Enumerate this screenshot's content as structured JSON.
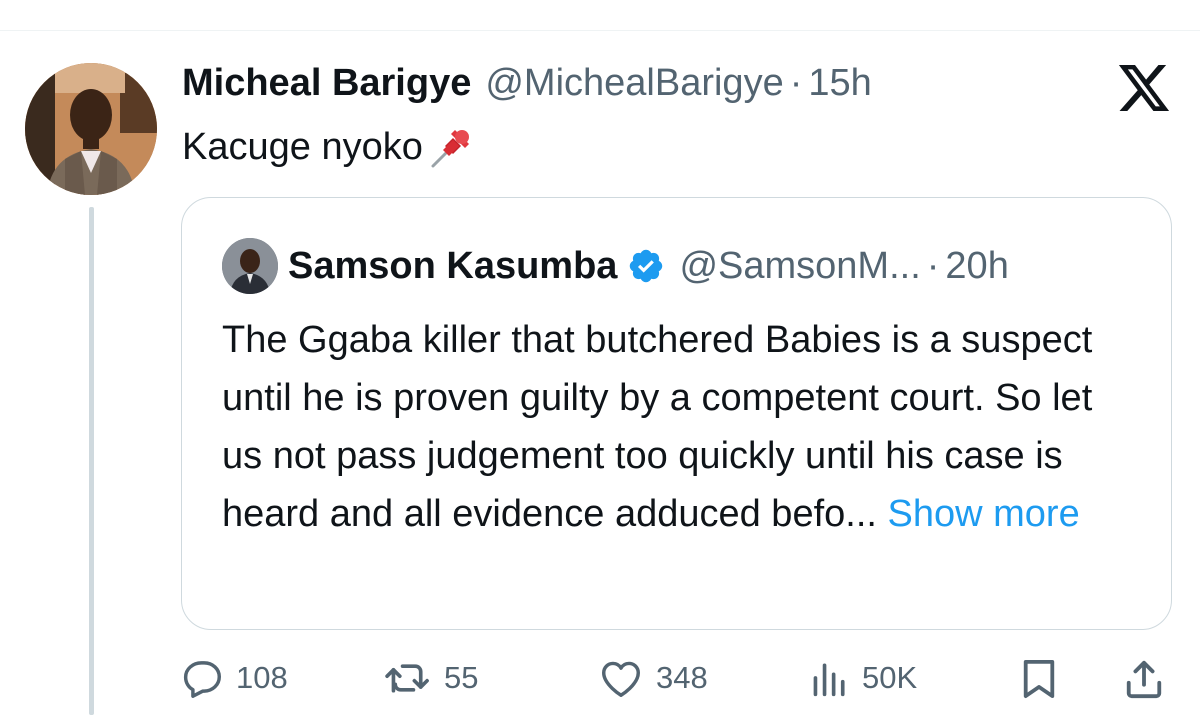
{
  "tweet": {
    "author_name": "Micheal Barigye",
    "author_handle": "@MichealBarigye",
    "separator": "·",
    "time": "15h",
    "text": "Kacuge nyoko",
    "text_emoji": "pushpin-icon"
  },
  "quote": {
    "author_name": "Samson Kasumba",
    "author_handle": "@SamsonM...",
    "separator": "·",
    "time": "20h",
    "text": "The Ggaba killer that butchered Babies is a suspect until he is proven guilty by a competent court. So let us not pass judgement too quickly until his case is heard and all evidence adduced befo...",
    "show_more": "Show more"
  },
  "actions": {
    "replies": "108",
    "reposts": "55",
    "likes": "348",
    "views": "50K"
  },
  "colors": {
    "text": "#0f1419",
    "secondary": "#536471",
    "link": "#1d9bf0",
    "border": "#cfd9de",
    "verified": "#1d9bf0",
    "pin": "#d92d34"
  },
  "icons": [
    "x-logo-icon",
    "pushpin-icon",
    "verified-badge-icon",
    "reply-icon",
    "repost-icon",
    "like-icon",
    "views-icon",
    "bookmark-icon",
    "share-icon"
  ]
}
